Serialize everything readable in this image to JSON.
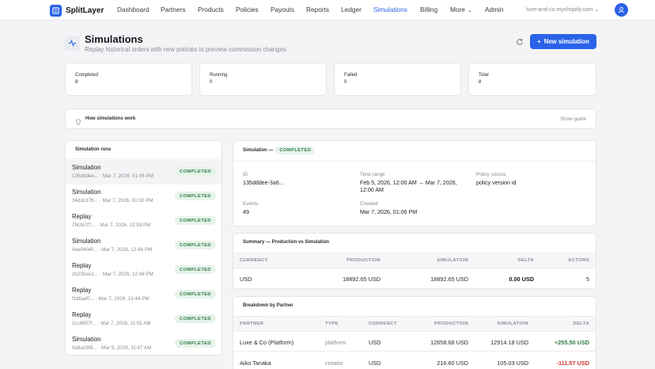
{
  "app": {
    "name": "SplitLayer"
  },
  "nav": [
    {
      "label": "Dashboard"
    },
    {
      "label": "Partners"
    },
    {
      "label": "Products"
    },
    {
      "label": "Policies"
    },
    {
      "label": "Payouts"
    },
    {
      "label": "Reports"
    },
    {
      "label": "Ledger"
    },
    {
      "label": "Simulations",
      "active": true
    },
    {
      "label": "Billing"
    },
    {
      "label": "More"
    },
    {
      "label": "Admin"
    }
  ],
  "store": {
    "label": "luxe-and-co.myshopify.com"
  },
  "header": {
    "title": "Simulations",
    "subtitle": "Replay historical orders with new policies to preview commission changes",
    "new_button": "New simulation",
    "new_button_icon": "+"
  },
  "stats": [
    {
      "label": "Completed",
      "value": "8"
    },
    {
      "label": "Running",
      "value": "0"
    },
    {
      "label": "Failed",
      "value": "0"
    },
    {
      "label": "Total",
      "value": "8"
    }
  ],
  "guide": {
    "title": "How simulations work",
    "action": "Show guide"
  },
  "runs": {
    "title": "Simulation runs",
    "items": [
      {
        "name": "Simulation",
        "id": "135dddee...",
        "date": "Mar 7, 2026, 01:06 PM",
        "status": "COMPLETED"
      },
      {
        "name": "Simulation",
        "id": "34ddc37b...",
        "date": "Mar 7, 2026, 01:00 PM",
        "status": "COMPLETED"
      },
      {
        "name": "Replay",
        "id": "7f4267f7...",
        "date": "Mar 7, 2026, 12:59 PM",
        "status": "COMPLETED"
      },
      {
        "name": "Simulation",
        "id": "0ee0404f...",
        "date": "Mar 7, 2026, 12:48 PM",
        "status": "COMPLETED"
      },
      {
        "name": "Replay",
        "id": "2b235ee1...",
        "date": "Mar 7, 2026, 12:46 PM",
        "status": "COMPLETED"
      },
      {
        "name": "Replay",
        "id": "f1bfaaf0...",
        "date": "Mar 7, 2026, 12:44 PM",
        "status": "COMPLETED"
      },
      {
        "name": "Replay",
        "id": "2cc6857f...",
        "date": "Mar 7, 2026, 11:55 AM",
        "status": "COMPLETED"
      },
      {
        "name": "Simulation",
        "id": "0a9a16f8...",
        "date": "Mar 5, 2026, 11:47 AM",
        "status": "COMPLETED"
      }
    ]
  },
  "detail": {
    "title": "Simulation —",
    "status": "COMPLETED",
    "id_label": "ID",
    "id_value": "135dddee-3a6...",
    "time_label": "Time range",
    "time_line1": "Feb 5, 2026, 12:00 AM → Mar 7, 2026,",
    "time_line2": "12:00 AM",
    "policy_label": "Policy source",
    "policy_value": "policy version id",
    "events_label": "Events",
    "events_value": "49",
    "created_label": "Created",
    "created_value": "Mar 7, 2026, 01:06 PM"
  },
  "summary": {
    "title": "Summary — Production vs Simulation",
    "headers": {
      "currency": "CURRENCY",
      "production": "PRODUCTION",
      "simulation": "SIMULATION",
      "delta": "DELTA",
      "actors": "ACTORS"
    },
    "row": {
      "currency": "USD",
      "production": "18892.65 USD",
      "simulation": "18892.65 USD",
      "delta": "0.00 USD",
      "actors": "5"
    }
  },
  "breakdown": {
    "title": "Breakdown by Partner",
    "headers": {
      "partner": "PARTNER",
      "type": "TYPE",
      "currency": "CURRENCY",
      "production": "PRODUCTION",
      "simulation": "SIMULATION",
      "delta": "DELTA"
    },
    "rows": [
      {
        "partner": "Luxe & Co (Platform)",
        "type": "platform",
        "currency": "USD",
        "production": "12658.68 USD",
        "simulation": "12914.18 USD",
        "delta": "+255.50 USD"
      },
      {
        "partner": "Aiko Tanaka",
        "type": "creator",
        "currency": "USD",
        "production": "216.60 USD",
        "simulation": "105.03 USD",
        "delta": "-111.57 USD"
      }
    ]
  },
  "colors": {
    "accent": "#2b63e8",
    "success": "#2f7d47",
    "danger": "#d3342f"
  }
}
